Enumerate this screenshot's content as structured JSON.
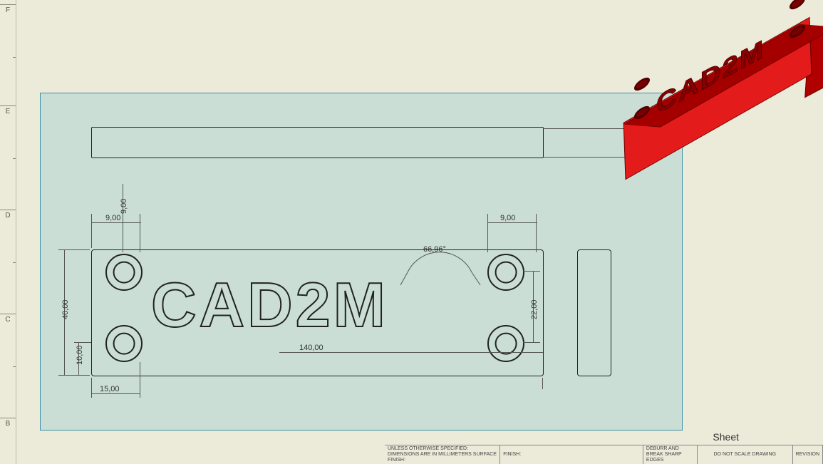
{
  "ruler": {
    "labels": [
      "F",
      "E",
      "D",
      "C",
      "B"
    ]
  },
  "dimensions": {
    "thickness": "10,00",
    "hole_top_dia": "9,00",
    "hole_off_x": "9,00",
    "hole_right_dia": "9,00",
    "height": "40,00",
    "off_y": "10,00",
    "off_x2": "15,00",
    "length": "140,00",
    "hole_gap_y": "22,00",
    "angle": "66,96°"
  },
  "embossed_text": "CAD2M",
  "sheet_label": "Sheet",
  "titleblock": {
    "c1": "UNLESS OTHERWISE SPECIFIED:\nDIMENSIONS ARE IN MILLIMETERS\nSURFACE FINISH:",
    "c2": "FINISH:",
    "c3": "DEBURR AND\nBREAK SHARP\nEDGES",
    "c4": "DO NOT SCALE DRAWING",
    "c5": "REVISION"
  }
}
